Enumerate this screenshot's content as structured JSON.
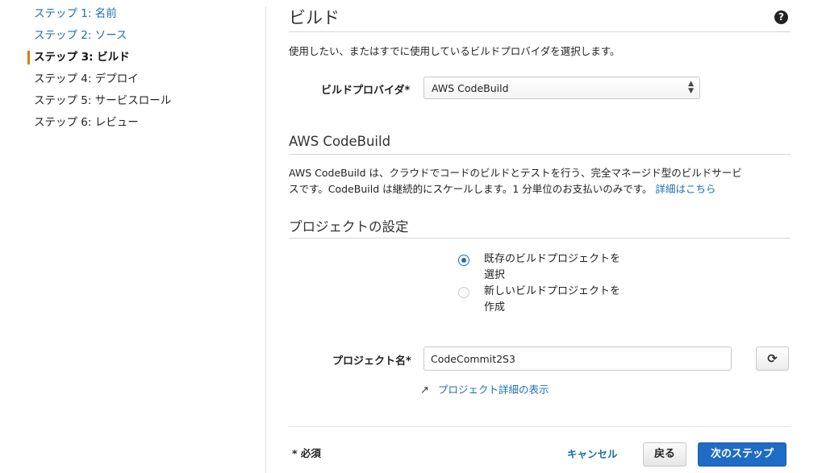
{
  "sidebar": {
    "steps": [
      {
        "label": "ステップ 1: 名前"
      },
      {
        "label": "ステップ 2: ソース"
      },
      {
        "label": "ステップ 3: ビルド"
      },
      {
        "label": "ステップ 4: デプロイ"
      },
      {
        "label": "ステップ 5: サービスロール"
      },
      {
        "label": "ステップ 6: レビュー"
      }
    ]
  },
  "main": {
    "title": "ビルド",
    "help_icon": "?",
    "description": "使用したい、またはすでに使用しているビルドプロバイダを選択します。",
    "provider": {
      "label": "ビルドプロバイダ*",
      "value": "AWS CodeBuild"
    },
    "codebuild": {
      "heading": "AWS CodeBuild",
      "text_line1": "AWS CodeBuild は、クラウドでコードのビルドとテストを行う、完全マネージド型のビルドサービ",
      "text_line2": "スです。CodeBuild は継続的にスケールします。1 分単位のお支払いのみです。",
      "more_link": "詳細はこちら"
    },
    "project": {
      "heading": "プロジェクトの設定",
      "radio_existing_line1": "既存のビルドプロジェクトを",
      "radio_existing_line2": "選択",
      "radio_new_line1": "新しいビルドプロジェクトを",
      "radio_new_line2": "作成",
      "selected": "existing",
      "name_label": "プロジェクト名*",
      "name_value": "CodeCommit2S3",
      "details_link": "プロジェクト詳細の表示"
    },
    "footer": {
      "required_note": "* 必須",
      "cancel": "キャンセル",
      "back": "戻る",
      "next": "次のステップ"
    }
  },
  "icons": {
    "help": "help-circle-icon",
    "refresh": "refresh-icon",
    "external": "external-link-icon",
    "select_arrows": "up-down-arrows-icon"
  },
  "colors": {
    "link": "#1d6db5",
    "active_step_bar": "#e07b00",
    "primary_button": "#1e6cc5"
  }
}
